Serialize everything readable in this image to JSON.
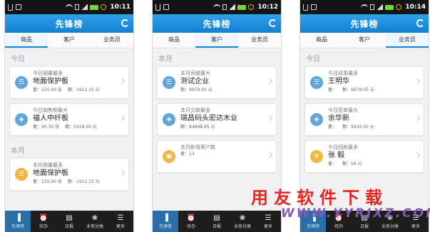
{
  "statusbar_times": [
    "10:11",
    "10:12",
    "10:14"
  ],
  "app": {
    "title": "先锋榜"
  },
  "tabs": [
    "商品",
    "客户",
    "业务员"
  ],
  "nav": [
    "先锋榜",
    "待办",
    "日报",
    "业务分类",
    "更多"
  ],
  "screens": [
    {
      "active_tab": 0,
      "sections": [
        {
          "label": "今日",
          "cards": [
            {
              "icon": "bar-chart-icon",
              "caption": "今日销量最多",
              "name": "地面保护板",
              "metrics": [
                "量：155.00 张",
                "额：1911.15 元"
              ]
            },
            {
              "icon": "tag-icon",
              "caption": "今日销售额最大",
              "name": "福人中纤板",
              "metrics": [
                "量：90.30 张",
                "额：5418.00 元"
              ]
            }
          ]
        },
        {
          "label": "本月",
          "cards": [
            {
              "icon": "bar-chart-icon",
              "color": "orange",
              "caption": "本月销量最多",
              "name": "地面保护板",
              "metrics": [
                "量：155.00 张",
                "额：1911.15 元"
              ]
            }
          ]
        }
      ]
    },
    {
      "active_tab": 1,
      "sections": [
        {
          "label": "本月",
          "cards": [
            {
              "icon": "bar-chart-icon",
              "caption": "本月贡献最大",
              "name": "测试企业",
              "metrics": [
                "额：9979.05 元"
              ]
            },
            {
              "icon": "tag-icon",
              "caption": "本月欠款最多",
              "name": "瑞昌码头宏达木业",
              "metrics": [
                "额：84898.95 元"
              ]
            },
            {
              "icon": "briefcase-icon",
              "color": "orange",
              "caption": "本月新增客户数",
              "name": "",
              "metrics": [
                "量：13"
              ]
            }
          ]
        }
      ]
    },
    {
      "active_tab": 2,
      "sections": [
        {
          "label": "今日",
          "cards": [
            {
              "icon": "bar-chart-icon",
              "caption": "今日成单最多",
              "name": "王明华",
              "metrics": [
                "量：",
                "额：9979.05 元"
              ]
            },
            {
              "icon": "tag-icon",
              "caption": "今日签单最大",
              "name": "余华新",
              "metrics": [
                "量：",
                "额：9543.30 元"
              ]
            },
            {
              "icon": "coin-icon",
              "color": "orange",
              "caption": "今日回款最多",
              "name": "张 毅",
              "metrics": [
                "量：",
                "额：56 元"
              ]
            }
          ]
        }
      ]
    }
  ],
  "watermark": {
    "top": "用友软件下载",
    "bottom": "WWW.YYRJXZ.COM"
  }
}
